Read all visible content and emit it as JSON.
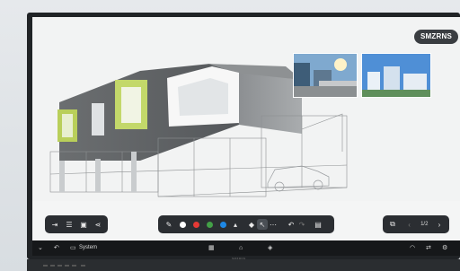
{
  "badge": {
    "text": "SMZRNS"
  },
  "toolbar_left": {
    "icons": [
      "exit-icon",
      "menu-icon",
      "save-icon",
      "share-icon"
    ]
  },
  "toolbar_center": {
    "colors": [
      "#ffffff",
      "#e53935",
      "#43a047",
      "#1e88e5"
    ],
    "selected_color": "#1e88e5",
    "tools": [
      "color-dropdown-icon",
      "eraser-icon",
      "pointer-icon",
      "more-icon",
      "undo-icon",
      "redo-icon",
      "delete-icon"
    ]
  },
  "toolbar_right": {
    "page_indicator": "1/2",
    "icons": [
      "pages-icon",
      "prev-page-icon",
      "next-page-icon"
    ]
  },
  "taskbar": {
    "system_label": "System",
    "icons": [
      "chevron-down-icon",
      "back-icon",
      "monitor-icon",
      "apps-grid-icon",
      "home-icon",
      "layers-icon",
      "wifi-icon",
      "swap-icon",
      "settings-icon"
    ]
  },
  "brand": {
    "text": "SMZRNS"
  }
}
